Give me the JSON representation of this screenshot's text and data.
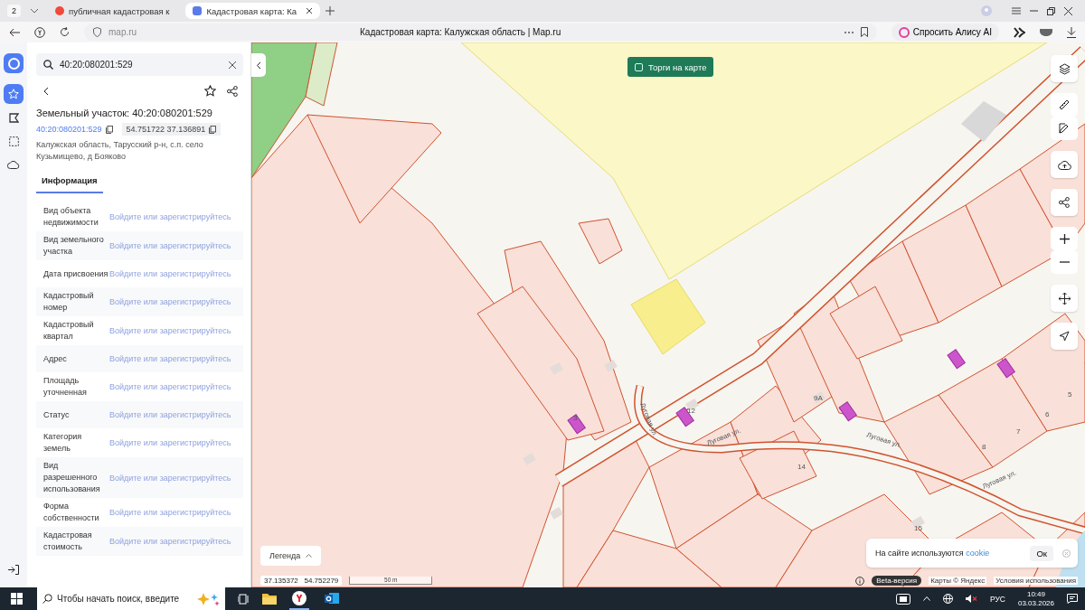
{
  "browser": {
    "tab_count": "2",
    "tabs": [
      {
        "title": "публичная кадастровая к",
        "selected": false
      },
      {
        "title": "Кадастровая карта: Ка",
        "selected": true
      }
    ],
    "url": "map.ru",
    "page_title": "Кадастровая карта: Калужская область | Map.ru",
    "alice_button": "Спросить Алису AI"
  },
  "rail": [
    {
      "kind": "favorites",
      "selected": true
    },
    {
      "kind": "polygon",
      "selected": false
    },
    {
      "kind": "selection",
      "selected": false
    },
    {
      "kind": "cloud",
      "selected": false
    }
  ],
  "search": {
    "value": "40:20:080201:529"
  },
  "parcel": {
    "title": "Земельный участок: 40:20:080201:529",
    "cad_number": "40:20:080201:529",
    "coords": "54.751722 37.136891",
    "address": "Калужская область, Тарусский р-н, с.п. село Кузьмищево, д Бояково"
  },
  "info_tabs": [
    {
      "label": "Информация",
      "selected": true
    }
  ],
  "properties": [
    {
      "label": "Вид объекта недвижимости",
      "value": "Войдите или зарегистрируйтесь"
    },
    {
      "label": "Вид земельного участка",
      "value": "Войдите или зарегистрируйтесь"
    },
    {
      "label": "Дата присвоения",
      "value": "Войдите или зарегистрируйтесь"
    },
    {
      "label": "Кадастровый номер",
      "value": "Войдите или зарегистрируйтесь"
    },
    {
      "label": "Кадастровый квартал",
      "value": "Войдите или зарегистрируйтесь"
    },
    {
      "label": "Адрес",
      "value": "Войдите или зарегистрируйтесь"
    },
    {
      "label": "Площадь уточненная",
      "value": "Войдите или зарегистрируйтесь"
    },
    {
      "label": "Статус",
      "value": "Войдите или зарегистрируйтесь"
    },
    {
      "label": "Категория земель",
      "value": "Войдите или зарегистрируйтесь"
    },
    {
      "label": "Вид разрешенного использования",
      "value": "Войдите или зарегистрируйтесь"
    },
    {
      "label": "Форма собственности",
      "value": "Войдите или зарегистрируйтесь"
    },
    {
      "label": "Кадастровая стоимость",
      "value": "Войдите или зарегистрируйтесь"
    }
  ],
  "map": {
    "auction_button": "Торги на карте",
    "house_numbers": [
      "3",
      "12",
      "9А",
      "14",
      "15",
      "8",
      "7",
      "6",
      "5"
    ],
    "street_labels": [
      "Луговая ул.",
      "Луговая ул.",
      "Луговая ул.",
      "Луговая ул."
    ],
    "legend": "Легенда",
    "cursor_coords": [
      "37.135372",
      "54.752279"
    ],
    "scale": "50 m",
    "cookie": {
      "text": "На сайте используются",
      "link": "cookie",
      "ok": "Ок"
    },
    "attribution": {
      "beta": "Beta-версия",
      "maps": "Карты © Яндекс",
      "terms": "Условия использования"
    }
  },
  "taskbar": {
    "search_placeholder": "Чтобы начать поиск, введите",
    "lang": "РУС",
    "time": "10:49",
    "date": "03.03.2026"
  }
}
